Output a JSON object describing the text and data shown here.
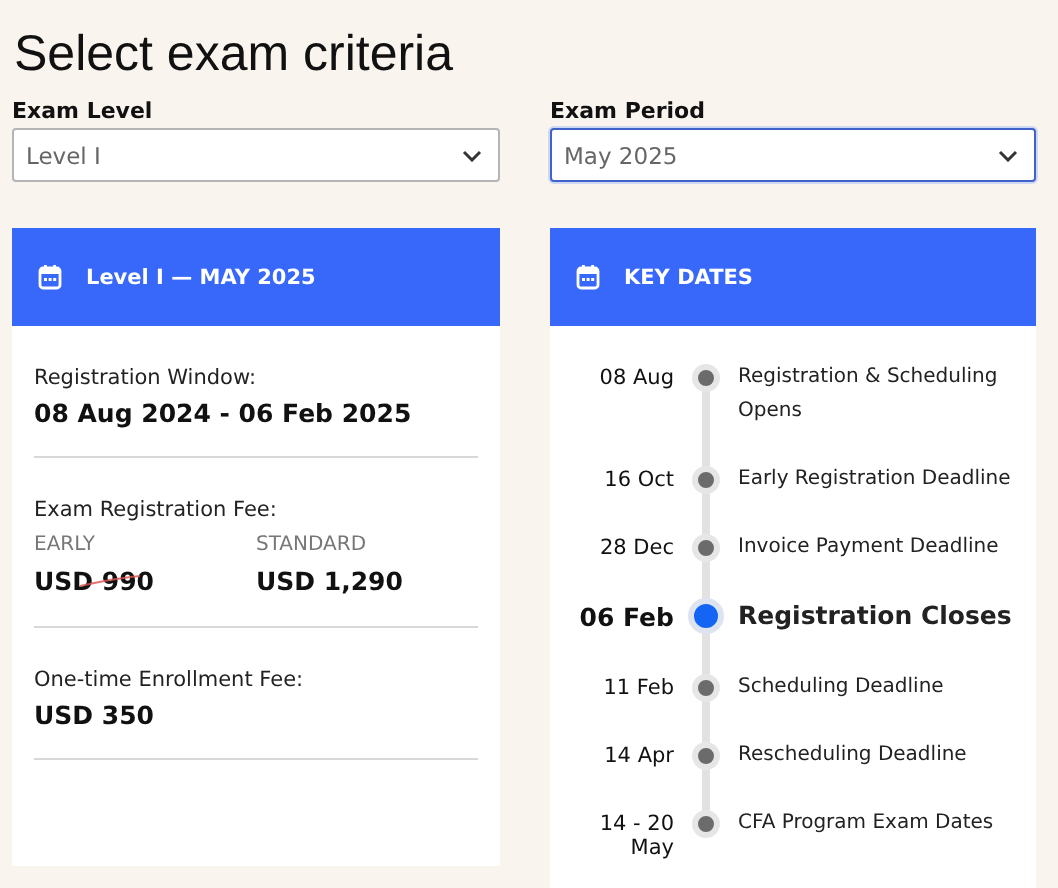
{
  "title": "Select exam criteria",
  "filters": [
    {
      "label": "Exam Level",
      "value": "Level I",
      "focused": false
    },
    {
      "label": "Exam Period",
      "value": "May 2025",
      "focused": true
    }
  ],
  "summary": {
    "heading": "Level I — MAY 2025",
    "registration_window": {
      "label": "Registration Window:",
      "value": "08 Aug 2024 - 06 Feb 2025"
    },
    "exam_fee": {
      "label": "Exam Registration Fee:",
      "tiers": [
        {
          "label": "EARLY",
          "price": "USD 990",
          "struck": true
        },
        {
          "label": "STANDARD",
          "price": "USD 1,290",
          "struck": false
        }
      ]
    },
    "enrollment_fee": {
      "label": "One-time Enrollment Fee:",
      "value": "USD 350"
    }
  },
  "key_dates": {
    "heading": "KEY DATES",
    "events": [
      {
        "date": "08 Aug",
        "name": "Registration & Scheduling Opens",
        "selected": false
      },
      {
        "date": "16 Oct",
        "name": "Early Registration Deadline",
        "selected": false
      },
      {
        "date": "28 Dec",
        "name": "Invoice Payment Deadline",
        "selected": false
      },
      {
        "date": "06 Feb",
        "name": "Registration Closes",
        "selected": true
      },
      {
        "date": "11 Feb",
        "name": "Scheduling Deadline",
        "selected": false
      },
      {
        "date": "14 Apr",
        "name": "Rescheduling Deadline",
        "selected": false
      },
      {
        "date": "14 - 20 May",
        "name": "CFA Program Exam Dates",
        "selected": false
      }
    ]
  }
}
